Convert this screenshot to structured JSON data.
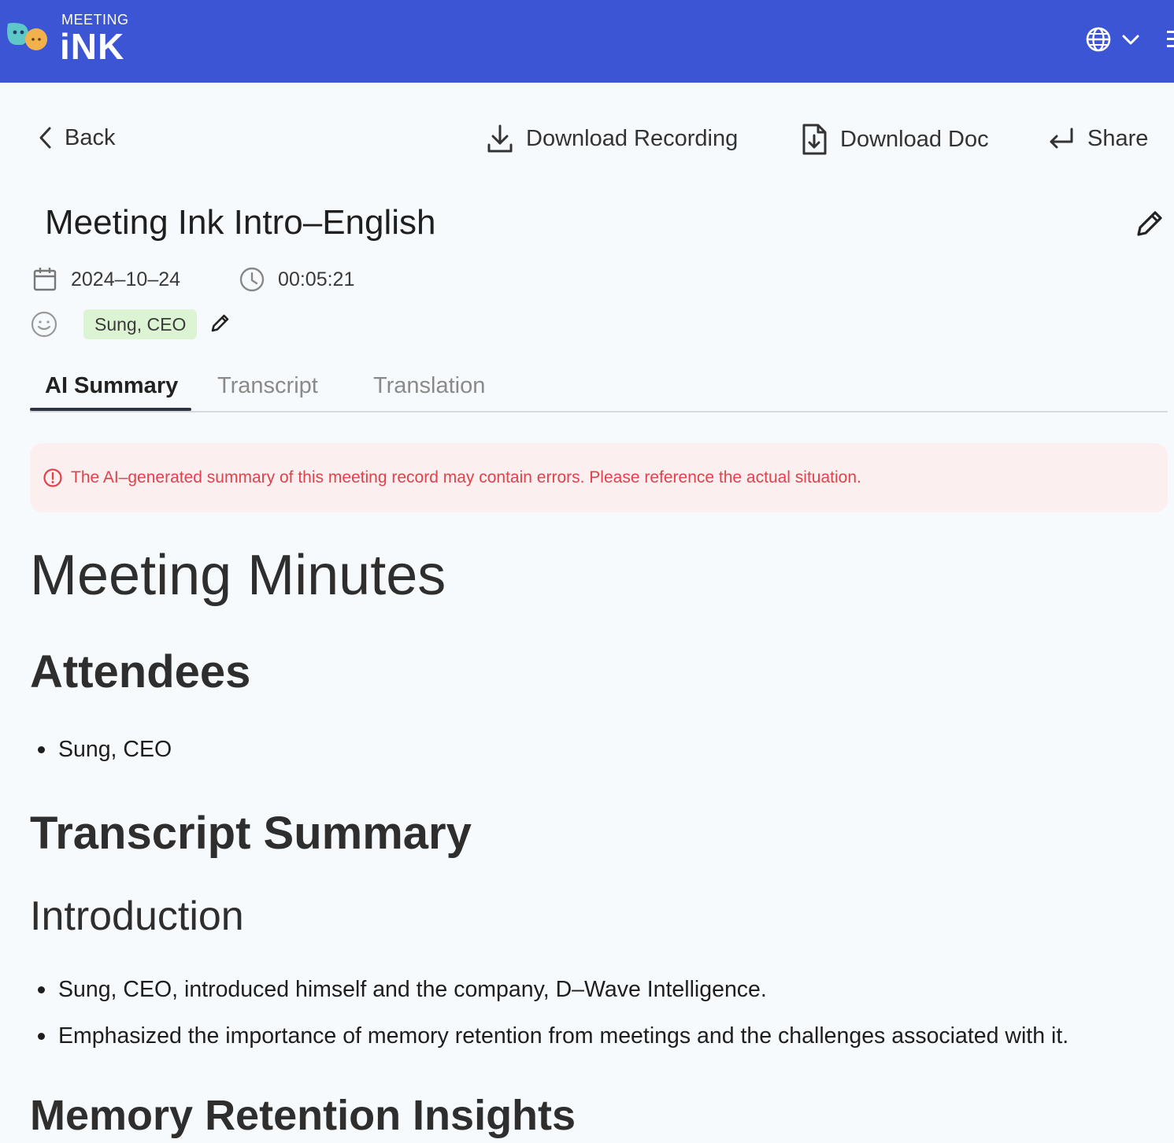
{
  "brand": {
    "top_text": "MEETING",
    "main_text": "iNK",
    "color": "#3b55d4"
  },
  "header": {
    "language_icon": "globe-icon",
    "menu_icon": "hamburger-icon"
  },
  "actions": {
    "back": "Back",
    "download_recording": "Download Recording",
    "download_doc": "Download Doc",
    "share": "Share"
  },
  "meeting": {
    "title": "Meeting Ink Intro–English",
    "date": "2024–10–24",
    "duration": "00:05:21",
    "speaker_tag": "Sung, CEO"
  },
  "tabs": [
    {
      "label": "AI Summary",
      "active": true
    },
    {
      "label": "Transcript",
      "active": false
    },
    {
      "label": "Translation",
      "active": false
    }
  ],
  "warning": {
    "text": "The AI–generated summary of this meeting record may contain errors. Please reference the actual situation.",
    "color": "#e0424b"
  },
  "summary": {
    "h1": "Meeting Minutes",
    "attendees_heading": "Attendees",
    "attendees": [
      "Sung, CEO"
    ],
    "transcript_summary_heading": "Transcript Summary",
    "introduction_heading": "Introduction",
    "introduction_points": [
      "Sung, CEO, introduced himself and the company, D–Wave Intelligence.",
      "Emphasized the importance of memory retention from meetings and the challenges associated with it."
    ],
    "memory_heading": "Memory Retention Insights"
  }
}
